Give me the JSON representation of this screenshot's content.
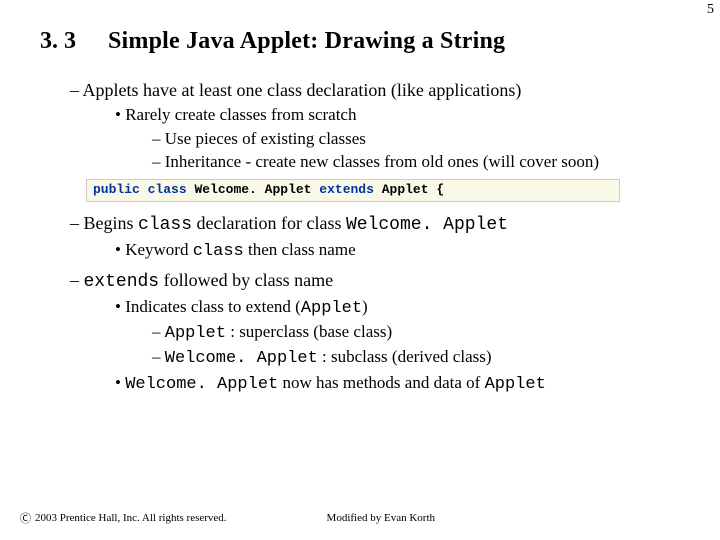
{
  "page_number": "5",
  "section_number": "3. 3",
  "section_title": "Simple Java Applet: Drawing a String",
  "dash1": "Applets have at least one class declaration (like applications)",
  "b1": "Rarely create classes from scratch",
  "sd1a": "Use pieces of existing classes",
  "sd1b": "Inheritance - create new classes from old ones (will cover soon)",
  "code": {
    "kw_public": "public",
    "kw_class": "class",
    "name1": "Welcome. Applet",
    "kw_extends": "extends",
    "name2": "Applet {"
  },
  "dash2_pre": "Begins ",
  "dash2_mono1": "class",
  "dash2_mid": " declaration for class ",
  "dash2_mono2": "Welcome. Applet",
  "b2_pre": "Keyword ",
  "b2_mono": "class",
  "b2_post": " then class name",
  "dash3_mono": "extends",
  "dash3_post": " followed by class name",
  "b3_pre": "Indicates class to extend (",
  "b3_mono": "Applet",
  "b3_post": ")",
  "sd3a_mono": "Applet",
  "sd3a_post": " : superclass (base class)",
  "sd3b_mono": "Welcome. Applet",
  "sd3b_post": " : subclass (derived class)",
  "b4_mono1": "Welcome. Applet",
  "b4_mid": " now has methods and data of ",
  "b4_mono2": "Applet",
  "footer_copy": "2003 Prentice Hall, Inc. All rights reserved.",
  "footer_mod": "Modified by Evan Korth"
}
